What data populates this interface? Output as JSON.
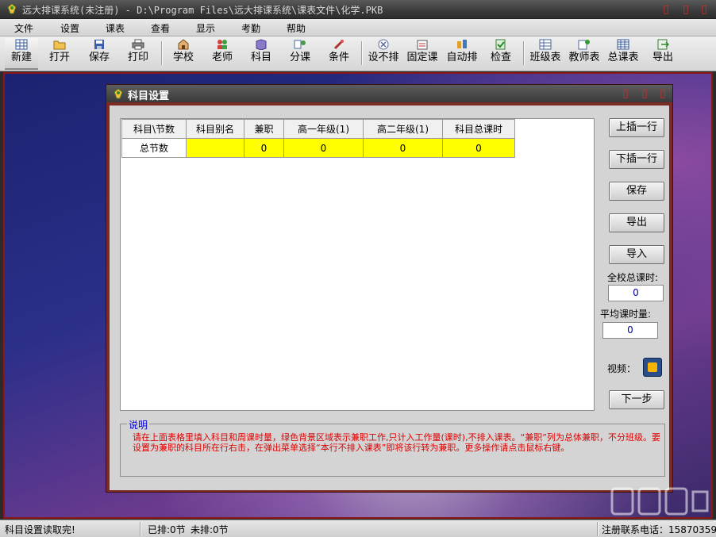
{
  "window": {
    "title": "远大排课系统(未注册) - D:\\Program Files\\远大排课系统\\课表文件\\化学.PKB",
    "controls": [
      "▯",
      "▯",
      "▯"
    ]
  },
  "menu": {
    "items": [
      "文件",
      "设置",
      "课表",
      "查看",
      "显示",
      "考勤",
      "帮助"
    ]
  },
  "toolbar": {
    "buttons": [
      {
        "label": "新建",
        "icon": "grid-new-icon"
      },
      {
        "label": "打开",
        "icon": "folder-open-icon"
      },
      {
        "label": "保存",
        "icon": "floppy-disk-icon"
      },
      {
        "label": "打印",
        "icon": "printer-icon"
      },
      {
        "label": "学校",
        "icon": "school-icon"
      },
      {
        "label": "老师",
        "icon": "teachers-icon"
      },
      {
        "label": "科目",
        "icon": "book-icon"
      },
      {
        "label": "分课",
        "icon": "assign-icon"
      },
      {
        "label": "条件",
        "icon": "condition-icon"
      },
      {
        "label": "设不排",
        "icon": "no-schedule-icon"
      },
      {
        "label": "固定课",
        "icon": "fixed-lesson-icon"
      },
      {
        "label": "自动排",
        "icon": "auto-schedule-icon"
      },
      {
        "label": "检查",
        "icon": "check-icon"
      },
      {
        "label": "班级表",
        "icon": "class-table-icon"
      },
      {
        "label": "教师表",
        "icon": "teacher-table-icon"
      },
      {
        "label": "总课表",
        "icon": "master-table-icon"
      },
      {
        "label": "导出",
        "icon": "export-icon"
      }
    ]
  },
  "dialog": {
    "title": "科目设置",
    "controls": [
      "▯",
      "▯",
      "▯"
    ],
    "grid": {
      "headers": [
        "科目\\节数",
        "科目别名",
        "兼职",
        "高一年级(1)",
        "高二年级(1)",
        "科目总课时"
      ],
      "rows": [
        [
          "总节数",
          "",
          "0",
          "0",
          "0",
          "0"
        ]
      ]
    },
    "buttons": {
      "insert_above": "上插一行",
      "insert_below": "下插一行",
      "save": "保存",
      "export": "导出",
      "import": "导入",
      "next": "下一步"
    },
    "school_total_hours": {
      "label": "全校总课时:",
      "value": "0"
    },
    "avg_hours": {
      "label": "平均课时量:",
      "value": "0"
    },
    "video": {
      "label": "视频："
    },
    "explanation": {
      "legend": "说明",
      "text": "请在上面表格里填入科目和周课时量，绿色背景区域表示兼职工作,只计入工作量(课时),不排入课表。“兼职”列为总体兼职，不分班级。要设置为兼职的科目所在行右击，在弹出菜单选择“本行不排入课表”即将该行转为兼职。更多操作请点击鼠标右键。"
    }
  },
  "status": {
    "message": "科目设置读取完!",
    "scheduled": "已排:0节",
    "unscheduled": "未排:0节",
    "registration": "注册联系电话：15870359"
  },
  "watermark": {
    "text": "下载吧"
  },
  "colors": {
    "yellow_cell": "#ffff00",
    "explain_text": "#e00000",
    "dialog_frame": "#7e2a24",
    "legend_text": "#0000cc"
  }
}
